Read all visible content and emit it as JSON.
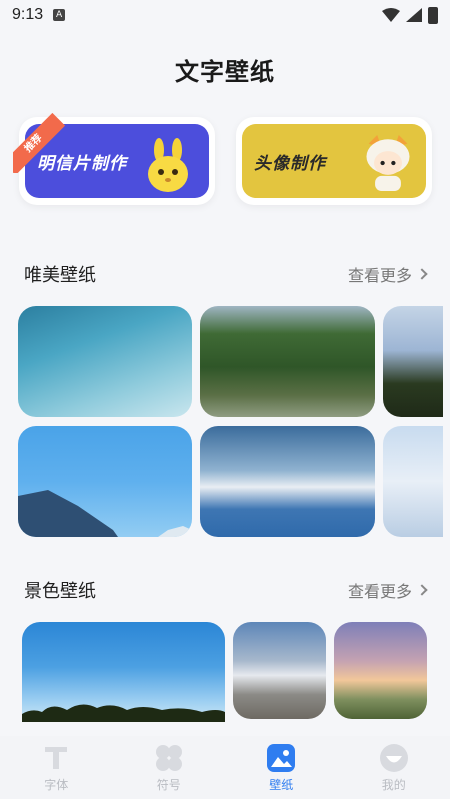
{
  "status_bar": {
    "time": "9:13",
    "notification_letter": "A"
  },
  "page": {
    "title": "文字壁纸"
  },
  "banners": [
    {
      "text": "明信片制作",
      "ribbon": "推荐",
      "icon": "bunny-mascot-icon"
    },
    {
      "text": "头像制作",
      "icon": "cat-hood-mascot-icon"
    }
  ],
  "sections": [
    {
      "title": "唯美壁纸",
      "see_more": "查看更多"
    },
    {
      "title": "景色壁纸",
      "see_more": "查看更多"
    }
  ],
  "bottom_nav": {
    "items": [
      {
        "label": "字体",
        "icon": "font-t-icon",
        "active": false
      },
      {
        "label": "符号",
        "icon": "clover-icon",
        "active": false
      },
      {
        "label": "壁纸",
        "icon": "image-icon",
        "active": true
      },
      {
        "label": "我的",
        "icon": "profile-icon",
        "active": false
      }
    ]
  },
  "colors": {
    "accent": "#2f7df0",
    "banner1": "#4c4edc",
    "banner2": "#e3c53f",
    "ribbon": "#f26a4b"
  }
}
